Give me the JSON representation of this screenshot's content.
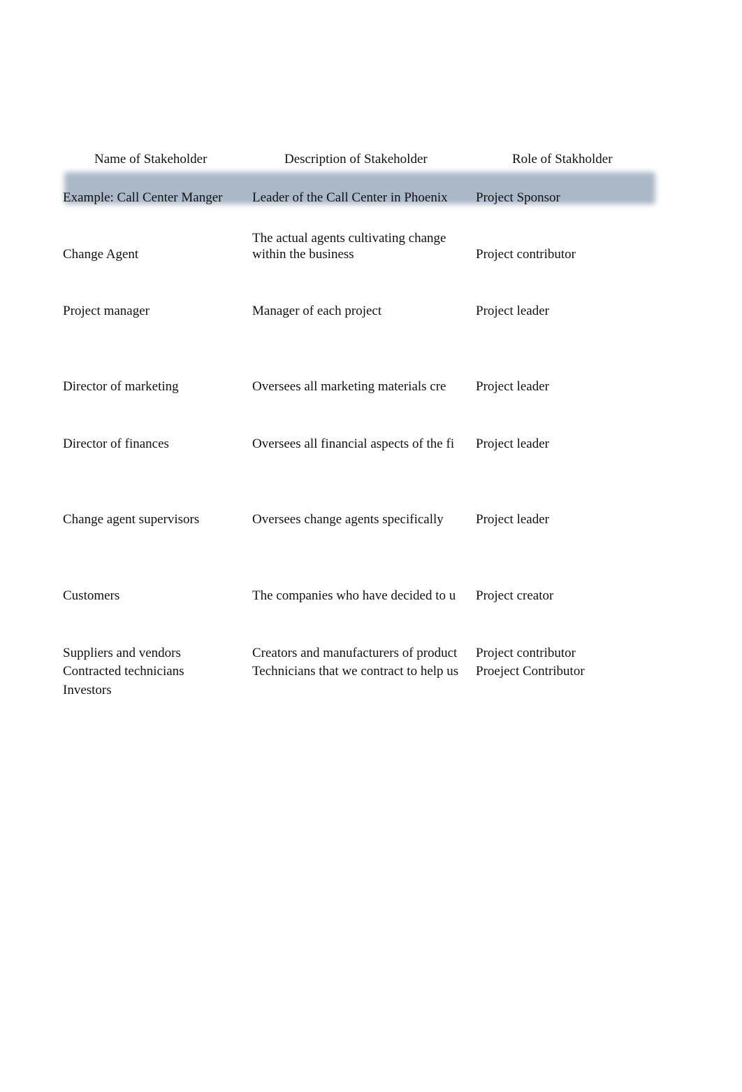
{
  "headers": {
    "name": "Name of Stakeholder",
    "description": "Description of Stakeholder",
    "role": "Role of Stakholder"
  },
  "example_row": {
    "name": "Example:  Call Center Manger",
    "description": "Leader of the Call Center in Phoenix",
    "role": "Project Sponsor",
    "highlight_color": "#aab8c8"
  },
  "rows": [
    {
      "name": "Change Agent",
      "description_line1": "The actual agents cultivating change",
      "description_line2": "within the business",
      "role": "Project contributor"
    },
    {
      "name": "Project manager",
      "description": "Manager of each project",
      "role": "Project leader"
    },
    {
      "name": "Director of marketing",
      "description": "Oversees all marketing materials cre",
      "role": "Project leader"
    },
    {
      "name": "Director of finances",
      "description": "Oversees all financial aspects of the fi",
      "role": "Project leader"
    },
    {
      "name": "Change agent supervisors",
      "description": "Oversees change agents specifically",
      "role": "Project leader"
    },
    {
      "name": "Customers",
      "description": "The companies who have decided to u",
      "role": "Project creator"
    },
    {
      "name": "Suppliers and vendors",
      "description": "Creators and manufacturers of product",
      "role": "Project contributor"
    },
    {
      "name": "Contracted technicians",
      "description": "Technicians that we contract to help us",
      "role": "Proeject Contributor"
    },
    {
      "name": "Investors",
      "description": "",
      "role": ""
    }
  ]
}
